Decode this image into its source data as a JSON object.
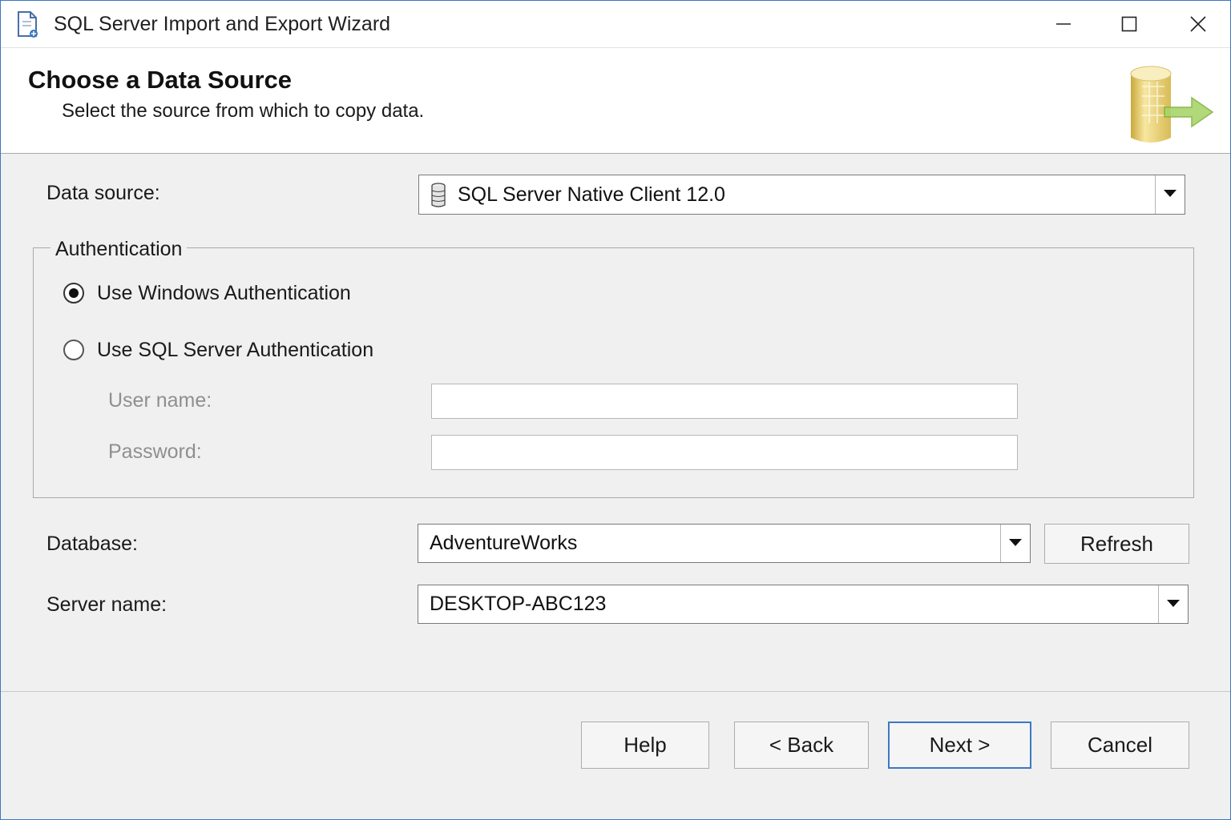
{
  "window": {
    "title": "SQL Server Import and Export Wizard",
    "controls": {
      "minimize": "minimize-icon",
      "maximize": "maximize-icon",
      "close": "close-icon"
    }
  },
  "header": {
    "title": "Choose a Data Source",
    "subtitle": "Select the source from which to copy data."
  },
  "form": {
    "data_source_label": "Data source:",
    "data_source_value": "SQL Server Native Client 12.0",
    "auth_group_label": "Authentication",
    "auth_windows_label": "Use  Windows Authentication",
    "auth_sql_label": "Use SQL Server  Authentication",
    "auth_selected": "windows",
    "username_label": "User name:",
    "username_value": "",
    "password_label": "Password:",
    "password_value": "",
    "database_label": "Database:",
    "database_value": "AdventureWorks",
    "refresh_label": "Refresh",
    "server_label": "Server name:",
    "server_value": "DESKTOP-ABC123"
  },
  "footer": {
    "help": "Help",
    "back": "< Back",
    "next": "Next >",
    "cancel": "Cancel"
  },
  "colors": {
    "accent": "#3b78c4",
    "background": "#f0f0f0",
    "disabled_text": "#8f8f8f"
  }
}
